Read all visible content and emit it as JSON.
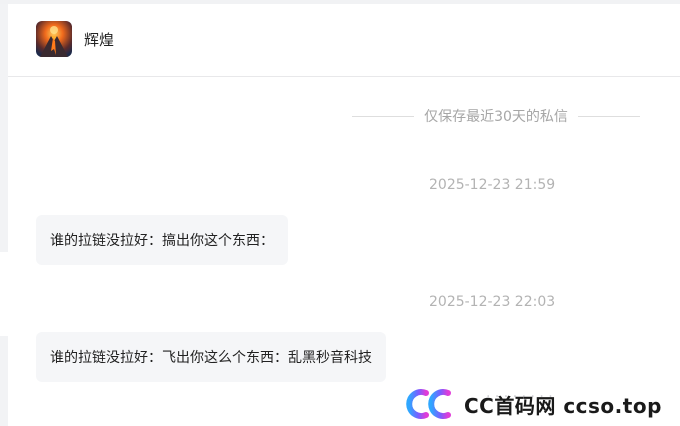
{
  "contact": {
    "name": "辉煌",
    "avatar_icon": "volcano-avatar"
  },
  "notice": {
    "text": "仅保存最近30天的私信"
  },
  "messages": [
    {
      "timestamp": "2025-12-23 21:59",
      "text": "谁的拉链没拉好：搞出你这个东西："
    },
    {
      "timestamp": "2025-12-23 22:03",
      "text": "谁的拉链没拉好：飞出你这么个东西：乱黑秒音科技"
    }
  ],
  "watermark": {
    "text": "CC首码网  ccso.top",
    "logo_icon": "cc-logo-icon"
  },
  "colors": {
    "bubble_bg": "#f5f6f8",
    "timestamp": "#b3b3b3",
    "notice_text": "#a6a6a6",
    "watermark_gradient_start": "#2fa7ff",
    "watermark_gradient_end": "#c23cff"
  }
}
